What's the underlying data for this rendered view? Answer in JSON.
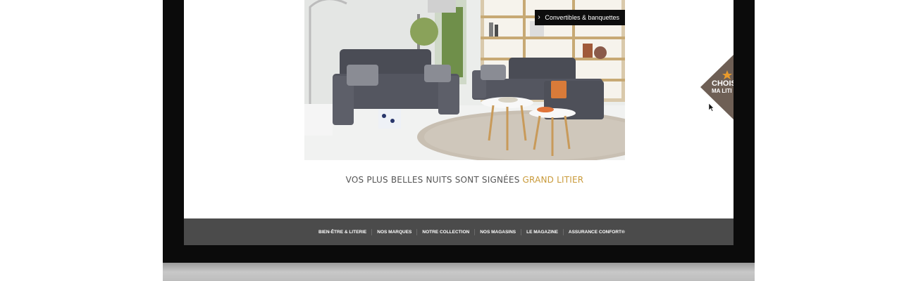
{
  "hero": {
    "category_tag": "Convertibles & banquettes",
    "chevron_icon": "chevron-right-icon"
  },
  "tagline": {
    "text": "VOS PLUS BELLES NUITS SONT SIGNÉES ",
    "brand": "GRAND LITIER",
    "brand_color": "#c99a3a"
  },
  "footer_nav": {
    "items": [
      {
        "label": "BIEN-ÊTRE & LITERIE"
      },
      {
        "label": "NOS MARQUES"
      },
      {
        "label": "NOTRE COLLECTION"
      },
      {
        "label": "NOS MAGASINS"
      },
      {
        "label": "LE MAGAZINE"
      },
      {
        "label": "ASSURANCE CONFORT®"
      }
    ]
  },
  "side_tab": {
    "line1": "CHOIS",
    "line2": "MA LITI",
    "color": "#6e5f55",
    "accent": "#e89a2c",
    "star_icon": "star-icon"
  },
  "cursor_icon": "mouse-pointer-icon"
}
